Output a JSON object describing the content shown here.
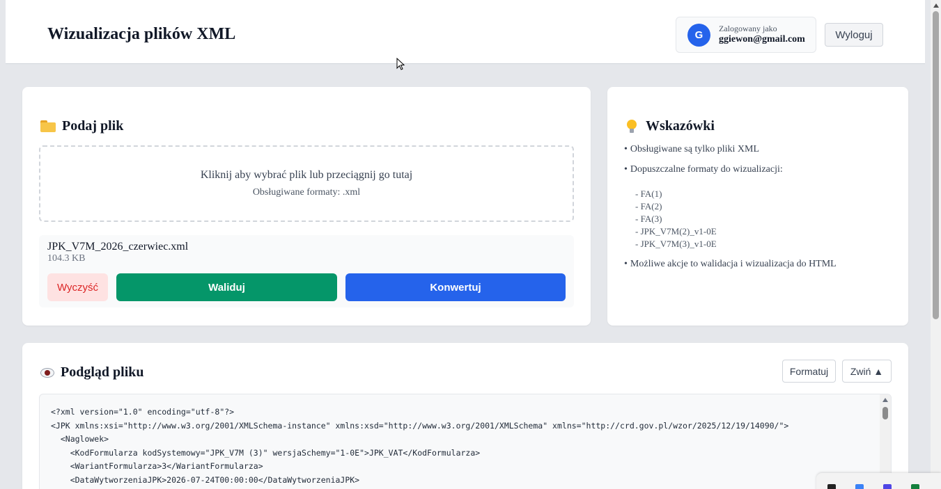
{
  "header": {
    "title": "Wizualizacja plików XML",
    "user_avatar_letter": "G",
    "user_caption": "Zalogowany jako",
    "user_email": "ggiewon@gmail.com",
    "logout_label": "Wyloguj"
  },
  "upload": {
    "title": "Podaj plik",
    "dropzone_text": "Kliknij aby wybrać plik lub przeciągnij go tutaj",
    "dropzone_formats": "Obsługiwane formaty: .xml",
    "file_name": "JPK_V7M_2026_czerwiec.xml",
    "file_size": "104.3 KB",
    "clear_label": "Wyczyść",
    "validate_label": "Waliduj",
    "convert_label": "Konwertuj"
  },
  "tips": {
    "title": "Wskazówki",
    "items": [
      "Obsługiwane są tylko pliki XML",
      "Dopuszczalne formaty do wizualizacji:",
      "Możliwe akcje to walidacja i wizualizacja do HTML"
    ],
    "formats": [
      "FA(1)",
      "FA(2)",
      "FA(3)",
      "JPK_V7M(2)_v1-0E",
      "JPK_V7M(3)_v1-0E"
    ]
  },
  "preview": {
    "title": "Podgląd pliku",
    "format_label": "Formatuj",
    "collapse_label": "Zwiń ▲",
    "code_lines": [
      "<?xml version=\"1.0\" encoding=\"utf-8\"?>",
      "<JPK xmlns:xsi=\"http://www.w3.org/2001/XMLSchema-instance\" xmlns:xsd=\"http://www.w3.org/2001/XMLSchema\" xmlns=\"http://crd.gov.pl/wzor/2025/12/19/14090/\">",
      "  <Naglowek>",
      "    <KodFormularza kodSystemowy=\"JPK_V7M (3)\" wersjaSchemy=\"1-0E\">JPK_VAT</KodFormularza>",
      "    <WariantFormularza>3</WariantFormularza>",
      "    <DataWytworzeniaJPK>2026-07-24T00:00:00</DataWytworzeniaJPK>"
    ]
  },
  "colors": {
    "accent_blue": "#2563eb",
    "accent_green": "#059669",
    "danger_bg": "#fee2e2",
    "danger_text": "#dc2626"
  }
}
